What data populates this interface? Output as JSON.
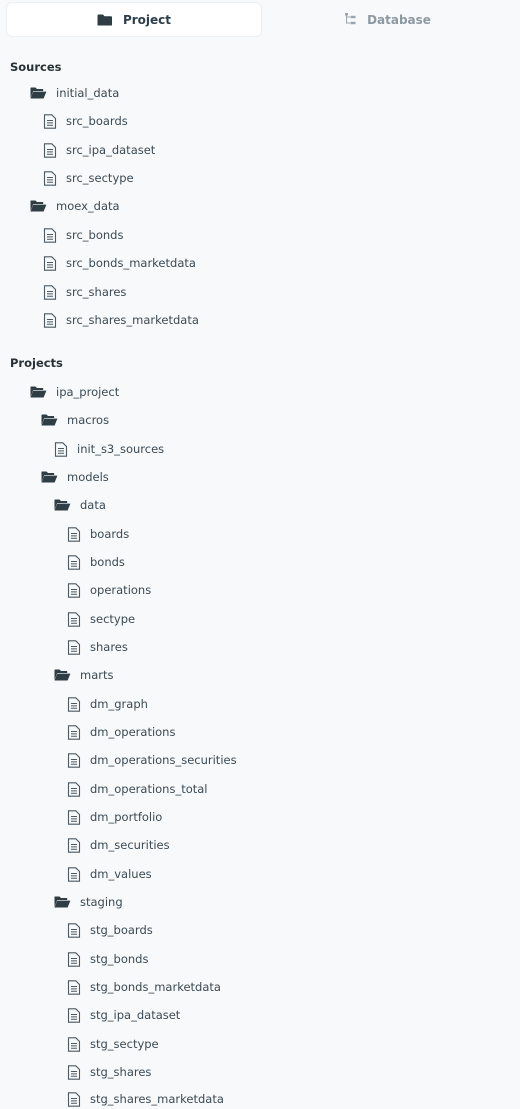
{
  "tabs": {
    "project_label": "Project",
    "database_label": "Database"
  },
  "sources": {
    "title": "Sources",
    "groups": [
      {
        "label": "initial_data",
        "files": [
          "src_boards",
          "src_ipa_dataset",
          "src_sectype"
        ]
      },
      {
        "label": "moex_data",
        "files": [
          "src_bonds",
          "src_bonds_marketdata",
          "src_shares",
          "src_shares_marketdata"
        ]
      }
    ]
  },
  "projects": {
    "title": "Projects",
    "root": "ipa_project",
    "macros": {
      "label": "macros",
      "files": [
        "init_s3_sources"
      ]
    },
    "models": {
      "label": "models",
      "data": {
        "label": "data",
        "files": [
          "boards",
          "bonds",
          "operations",
          "sectype",
          "shares"
        ]
      },
      "marts": {
        "label": "marts",
        "files": [
          "dm_graph",
          "dm_operations",
          "dm_operations_securities",
          "dm_operations_total",
          "dm_portfolio",
          "dm_securities",
          "dm_values"
        ]
      },
      "staging": {
        "label": "staging",
        "files": [
          "stg_boards",
          "stg_bonds",
          "stg_bonds_marketdata",
          "stg_ipa_dataset",
          "stg_sectype",
          "stg_shares",
          "stg_shares_marketdata"
        ]
      }
    }
  },
  "icons": {
    "folder": "folder-open-icon",
    "file": "file-icon",
    "project_tab": "folder-icon",
    "database_tab": "tree-icon"
  }
}
